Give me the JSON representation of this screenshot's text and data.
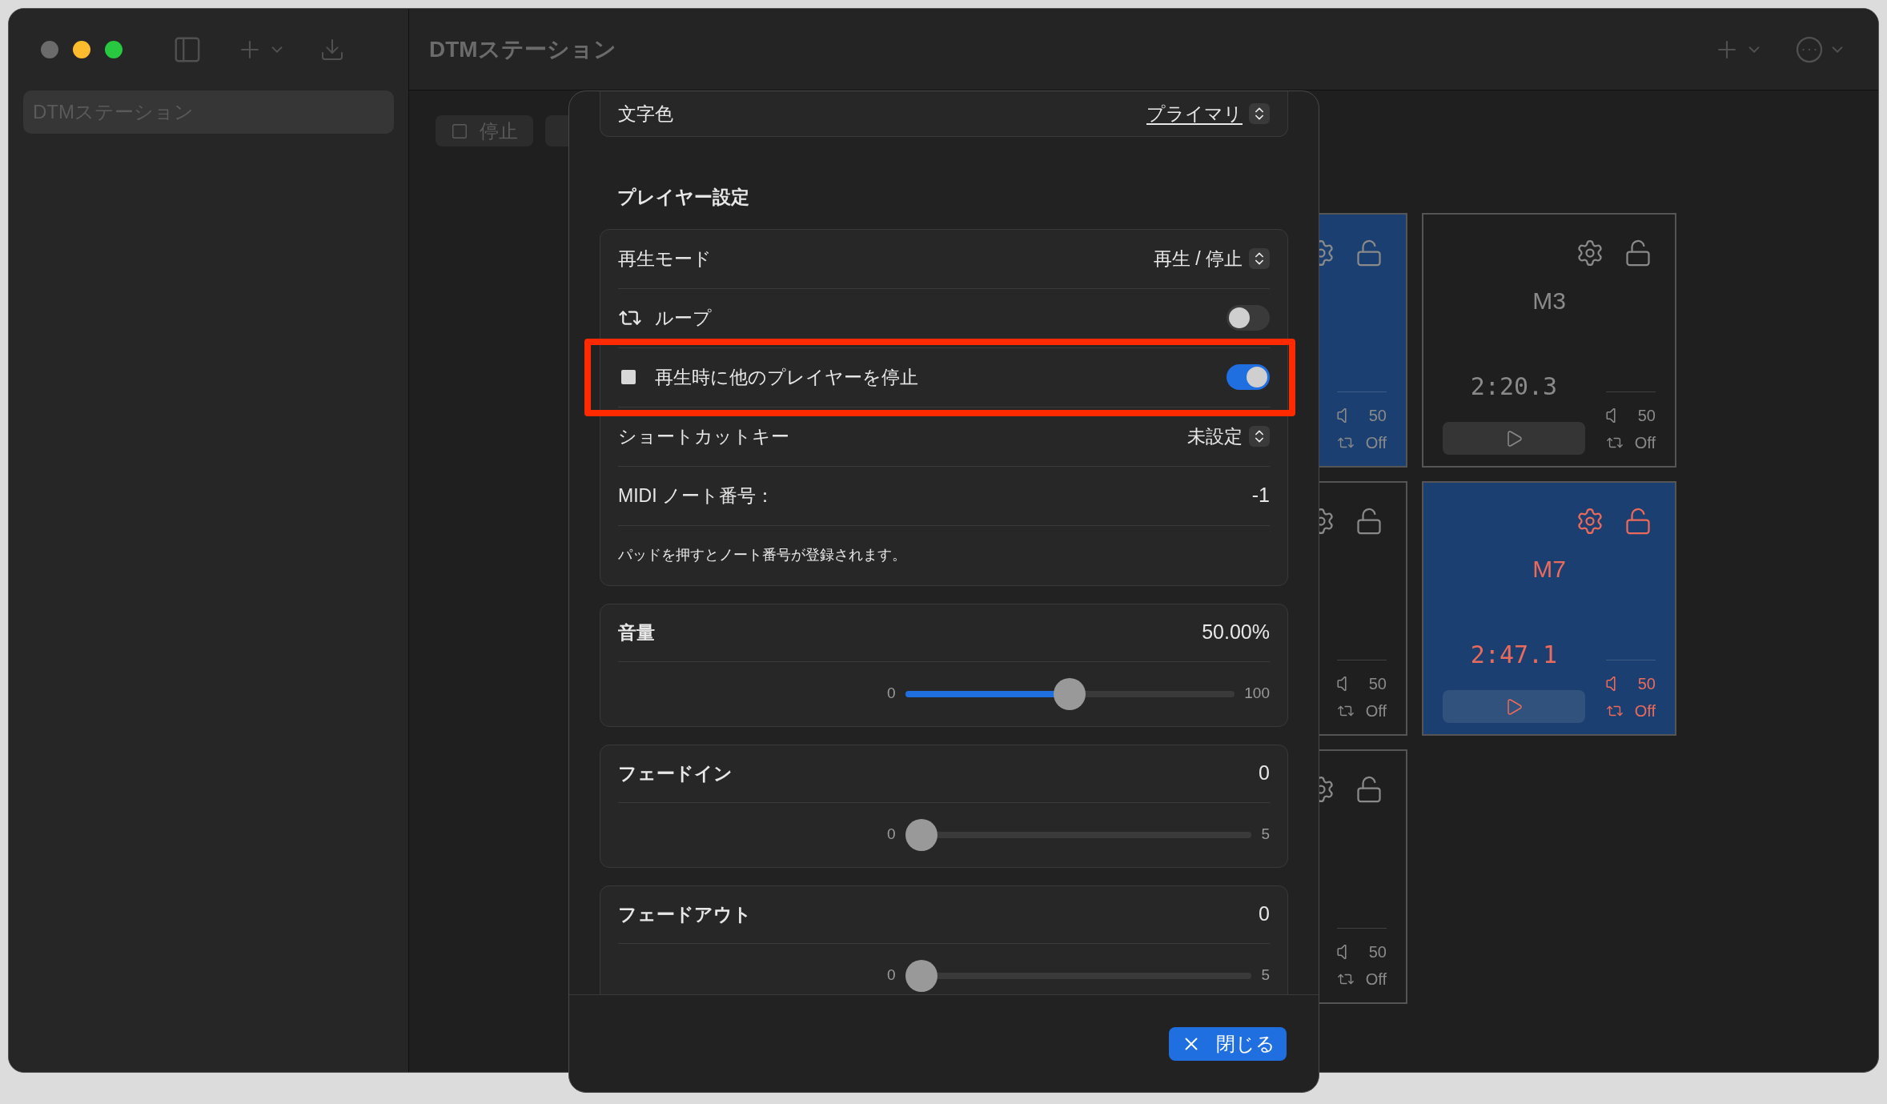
{
  "window": {
    "title": "DTMステーション"
  },
  "sidebar": {
    "items": [
      {
        "label": "DTMステーション",
        "selected": true
      }
    ]
  },
  "toolbar": {
    "buttons": [
      {
        "label": "停止"
      }
    ]
  },
  "pads": [
    {
      "color": "#1b3f70",
      "kind": "plain",
      "volume": "50",
      "loop": "Off"
    },
    {
      "name": "M3",
      "time": "2:20.3",
      "color": "#1f1f1f",
      "kind": "plain",
      "volume": "50",
      "loop": "Off"
    },
    {
      "color": "#1f1f1f",
      "kind": "plain",
      "volume": "50",
      "loop": "Off"
    },
    {
      "name": "M7",
      "time": "2:47.1",
      "color": "#1b3f70",
      "kind": "red",
      "volume": "50",
      "loop": "Off"
    },
    {
      "color": "#1f1f1f",
      "kind": "plain",
      "volume": "50",
      "loop": "Off"
    }
  ],
  "dialog": {
    "text_color_row": {
      "label": "文字色",
      "value": "プライマリ"
    },
    "player_section": {
      "title": "プレイヤー設定",
      "play_mode": {
        "label": "再生モード",
        "value": "再生 / 停止"
      },
      "loop": {
        "label": "ループ",
        "on": false
      },
      "stop_others": {
        "label": "再生時に他のプレイヤーを停止",
        "on": true,
        "highlighted": true
      },
      "shortcut": {
        "label": "ショートカットキー",
        "value": "未設定"
      },
      "midi": {
        "label": "MIDI ノート番号：",
        "value": "-1"
      },
      "hint": "パッドを押すとノート番号が登録されます。"
    },
    "sliders": [
      {
        "label": "音量",
        "reading": "50.00%",
        "min": "0",
        "max": "100",
        "level": 0.5
      },
      {
        "label": "フェードイン",
        "reading": "0",
        "min": "0",
        "max": "5",
        "level": 0
      },
      {
        "label": "フェードアウト",
        "reading": "0",
        "min": "0",
        "max": "5",
        "level": 0
      }
    ],
    "close_button": "閉じる"
  }
}
